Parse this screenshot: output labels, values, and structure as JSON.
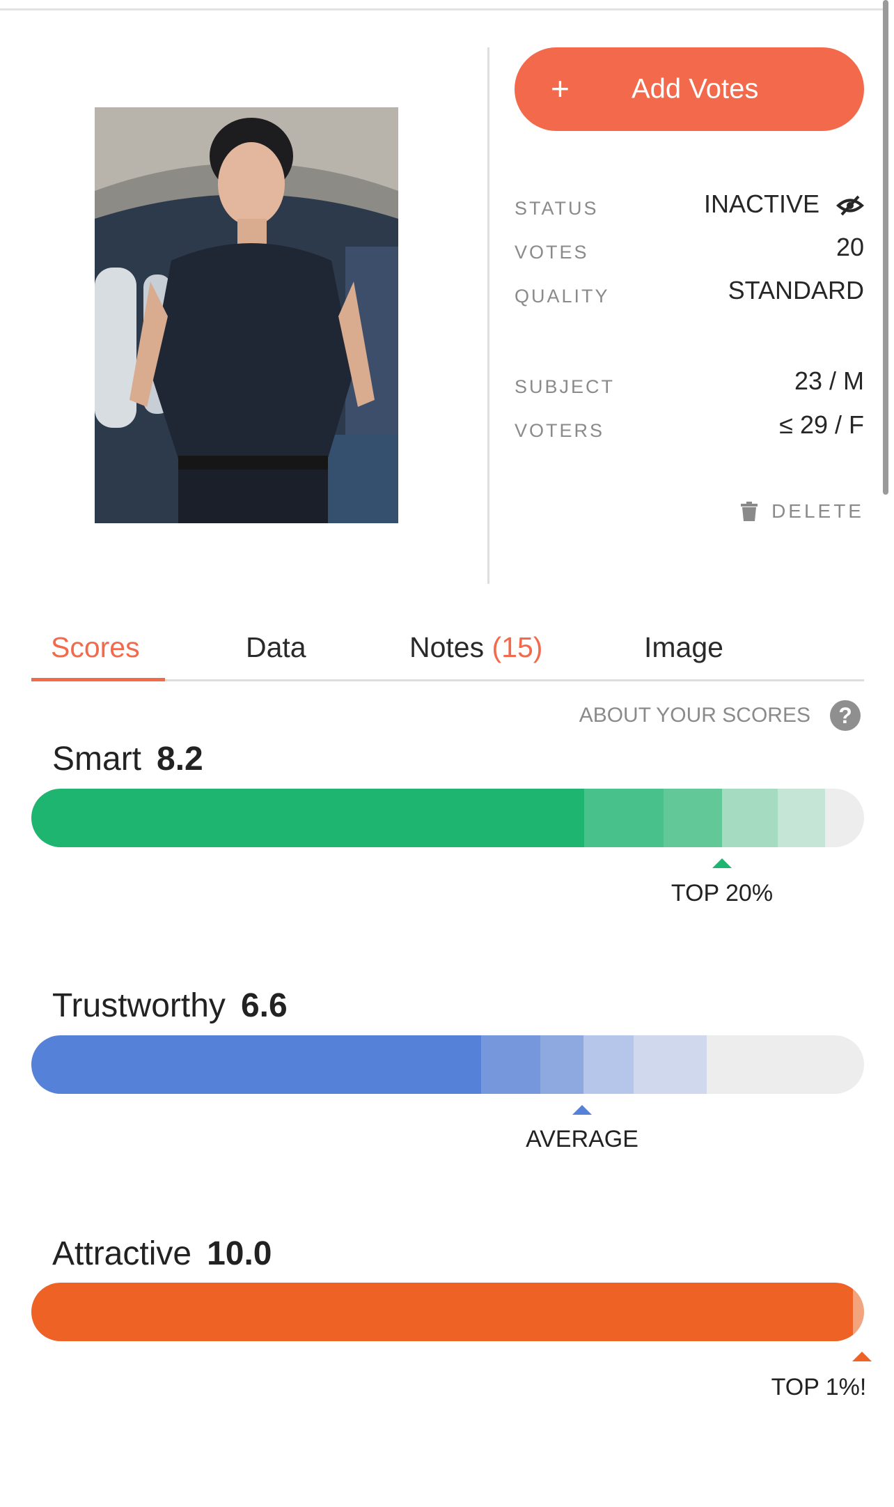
{
  "actions": {
    "add_votes_plus": "+",
    "add_votes_label": "Add Votes",
    "delete_label": "DELETE"
  },
  "info": {
    "status_label": "STATUS",
    "status_value": "INACTIVE",
    "votes_label": "VOTES",
    "votes_value": "20",
    "quality_label": "QUALITY",
    "quality_value": "STANDARD",
    "subject_label": "SUBJECT",
    "subject_value": "23 / M",
    "voters_label": "VOTERS",
    "voters_value": "≤ 29 / F"
  },
  "tabs": {
    "scores": "Scores",
    "data": "Data",
    "notes": "Notes",
    "notes_count": "(15)",
    "image": "Image",
    "active": "Scores"
  },
  "about_label": "ABOUT YOUR SCORES",
  "about_icon": "?",
  "scores": [
    {
      "name": "Smart",
      "score": "8.2",
      "marker_label": "TOP 20%",
      "level": 0.83,
      "color": "#1db570"
    },
    {
      "name": "Trustworthy",
      "score": "6.6",
      "marker_label": "AVERAGE",
      "level": 0.66,
      "color": "#4f7fd8"
    },
    {
      "name": "Attractive",
      "score": "10.0",
      "marker_label": "TOP 1%!",
      "level": 1.0,
      "color": "#ee6225"
    }
  ],
  "icons": {
    "status": "eye-off-icon",
    "delete": "trash-icon",
    "help": "question-circle-icon"
  }
}
